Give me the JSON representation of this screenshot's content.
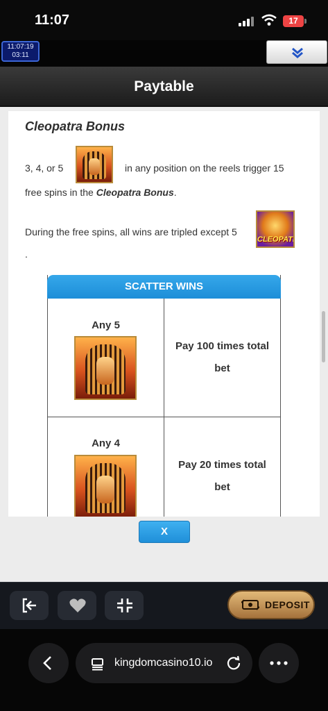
{
  "status_bar": {
    "time": "11:07",
    "battery": "17"
  },
  "game": {
    "clock_time": "11:07:19",
    "clock_elapsed": "03:11"
  },
  "header": {
    "title": "Paytable"
  },
  "bonus": {
    "title": "Cleopatra Bonus",
    "line1_prefix": "3, 4, or 5",
    "line1_suffix": "in any position on the reels trigger 15",
    "line2_prefix": "free spins in the",
    "line2_bold": "Cleopatra Bonus",
    "line2_suffix": ".",
    "line3": "During the free spins, all wins are tripled except 5",
    "line4": ".",
    "cleo_symbol_text": "CLEOPATRA"
  },
  "scatter": {
    "title": "SCATTER WINS",
    "rows": [
      {
        "label": "Any 5",
        "pay_line1": "Pay 100 times total",
        "pay_line2": "bet"
      },
      {
        "label": "Any 4",
        "pay_line1": "Pay 20 times total",
        "pay_line2": "bet"
      }
    ]
  },
  "close_label": "X",
  "toolbar": {
    "deposit_label": "DEPOSIT"
  },
  "browser": {
    "url": "kingdomcasino10.io"
  },
  "colors": {
    "accent": "#1f8fd9",
    "header_bg": "#2a2a2a",
    "deposit_gold": "#c8955a"
  }
}
